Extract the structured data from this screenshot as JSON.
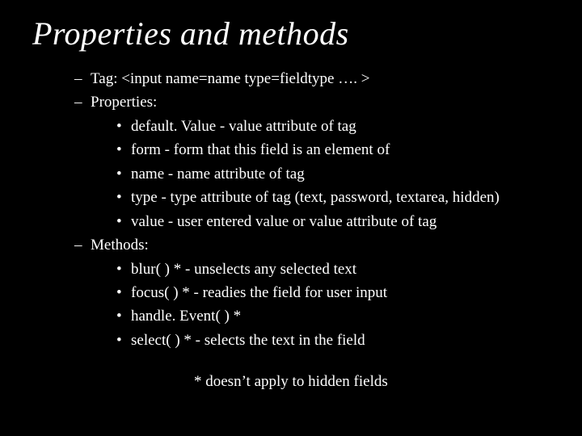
{
  "title": "Properties and methods",
  "items": {
    "tag": "Tag: <input name=name type=fieldtype …. >",
    "propsHeader": "Properties:",
    "props": [
      "default. Value - value attribute of tag",
      "form - form that this field is an element of",
      "name - name attribute of tag",
      "type - type attribute of tag (text, password, textarea, hidden)",
      "value - user entered value or value attribute of tag"
    ],
    "methodsHeader": "Methods:",
    "methods": [
      "blur( ) * - unselects any selected text",
      "focus( ) * - readies the field for user input",
      "handle. Event( ) *",
      "select( ) * - selects the text in the field"
    ]
  },
  "footnote": "* doesn’t apply to hidden fields",
  "glyphs": {
    "dash": "–",
    "dot": "•"
  }
}
